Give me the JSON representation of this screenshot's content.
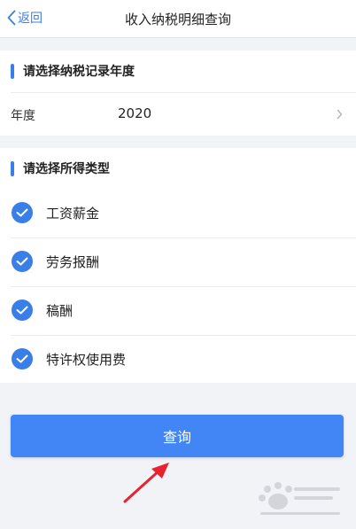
{
  "nav": {
    "back_label": "返回",
    "title": "收入纳税明细查询"
  },
  "year_section": {
    "title": "请选择纳税记录年度",
    "row_label": "年度",
    "row_value": "2020"
  },
  "type_section": {
    "title": "请选择所得类型",
    "options": [
      {
        "label": "工资薪金",
        "checked": true
      },
      {
        "label": "劳务报酬",
        "checked": true
      },
      {
        "label": "稿酬",
        "checked": true
      },
      {
        "label": "特许权使用费",
        "checked": true
      }
    ]
  },
  "query_button": {
    "label": "查询"
  },
  "colors": {
    "accent": "#3a7ee8",
    "button": "#4286f5",
    "arrow": "#e8232f",
    "background": "#f2f3f7"
  },
  "icons": {
    "back": "chevron-left-icon",
    "year_picker": "chevron-right-icon",
    "checked": "check-circle-icon",
    "pointer": "red-arrow-icon",
    "watermark": "baidu-watermark-icon"
  }
}
